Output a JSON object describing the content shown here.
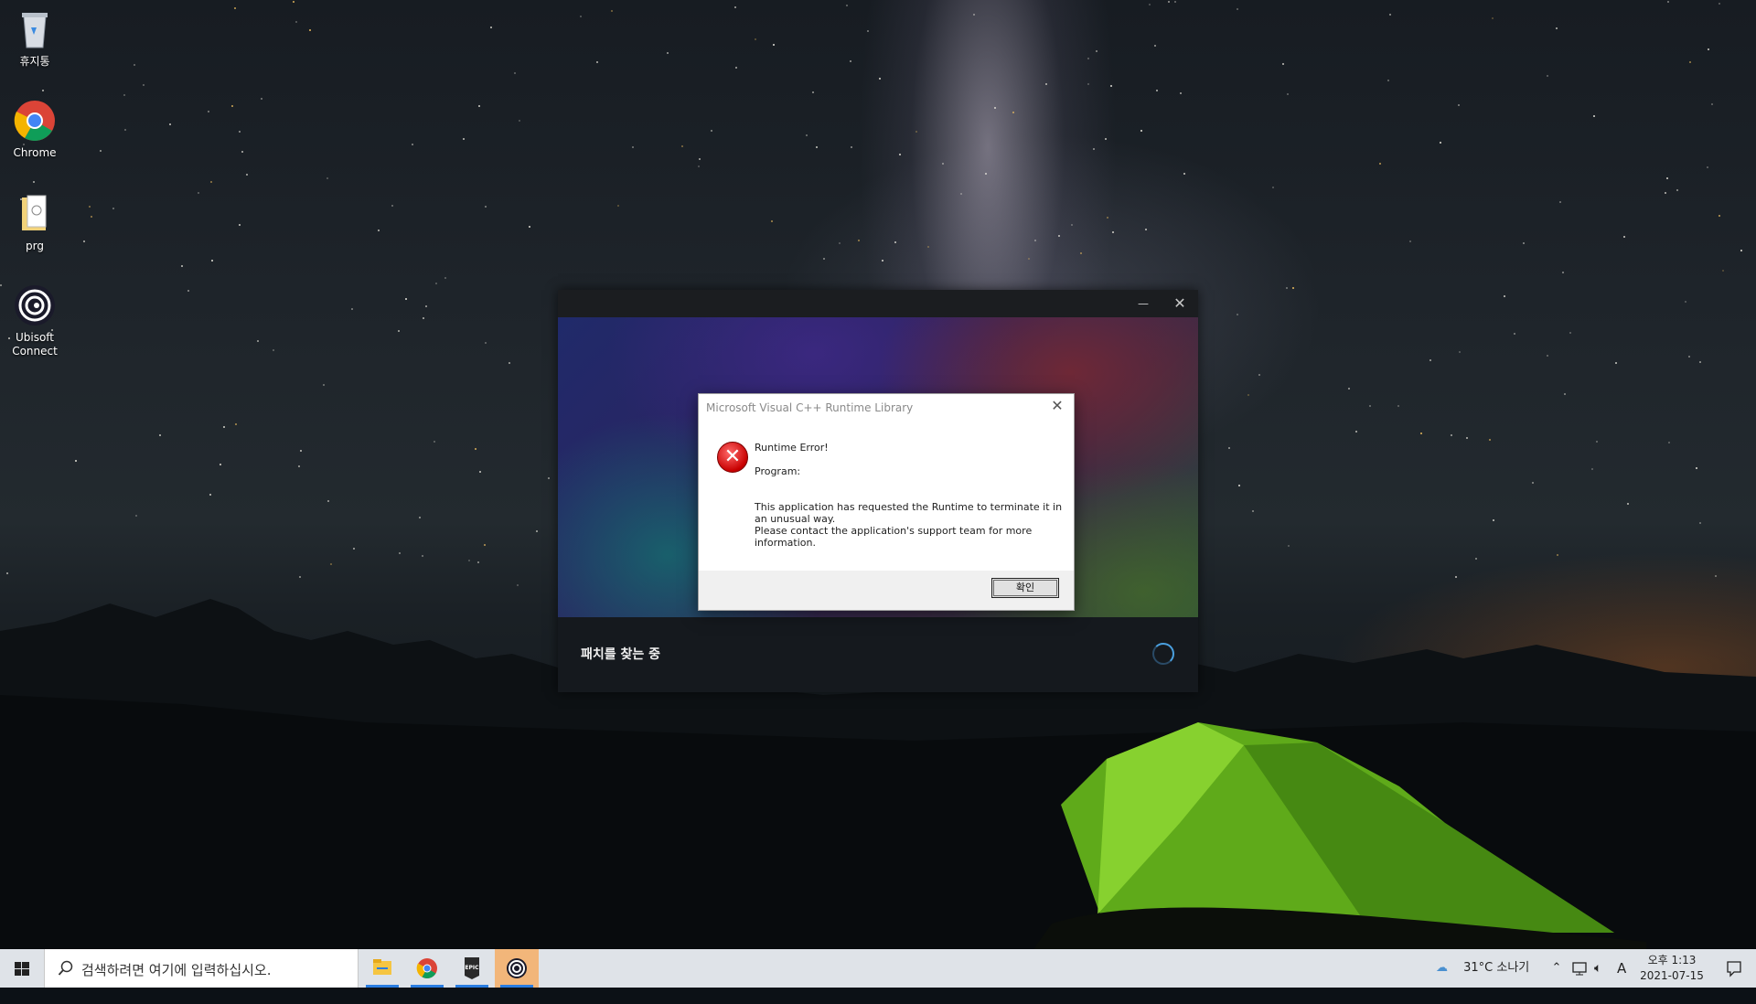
{
  "desktop": {
    "icons": [
      {
        "label": "휴지통"
      },
      {
        "label": "Chrome"
      },
      {
        "label": "prg"
      },
      {
        "label": "Ubisoft Connect"
      }
    ]
  },
  "launcher": {
    "minimize_glyph": "—",
    "close_glyph": "✕",
    "status_text": "패치를 찾는 중"
  },
  "dialog": {
    "title": "Microsoft Visual C++ Runtime Library",
    "close_glyph": "✕",
    "heading": "Runtime Error!",
    "program_label": "Program:",
    "message_line1": "This application has requested the Runtime to terminate it in",
    "message_line2": "an unusual way.",
    "message_line3": "Please contact the application's support team for more",
    "message_line4": "information.",
    "ok_label": "확인",
    "icon_glyph": "✕"
  },
  "taskbar": {
    "search_placeholder": "검색하려면 여기에 입력하십시오.",
    "apps": [
      "file-explorer",
      "chrome",
      "epic-games",
      "ubisoft-connect"
    ],
    "epic_label": "EPIC",
    "weather": "31°C  소나기",
    "ime": "A",
    "clock_time": "오후 1:13",
    "clock_date": "2021-07-15"
  },
  "colors": {
    "accent": "#2a7de0",
    "error_red": "#c80000",
    "active_app": "#f2b67a"
  }
}
